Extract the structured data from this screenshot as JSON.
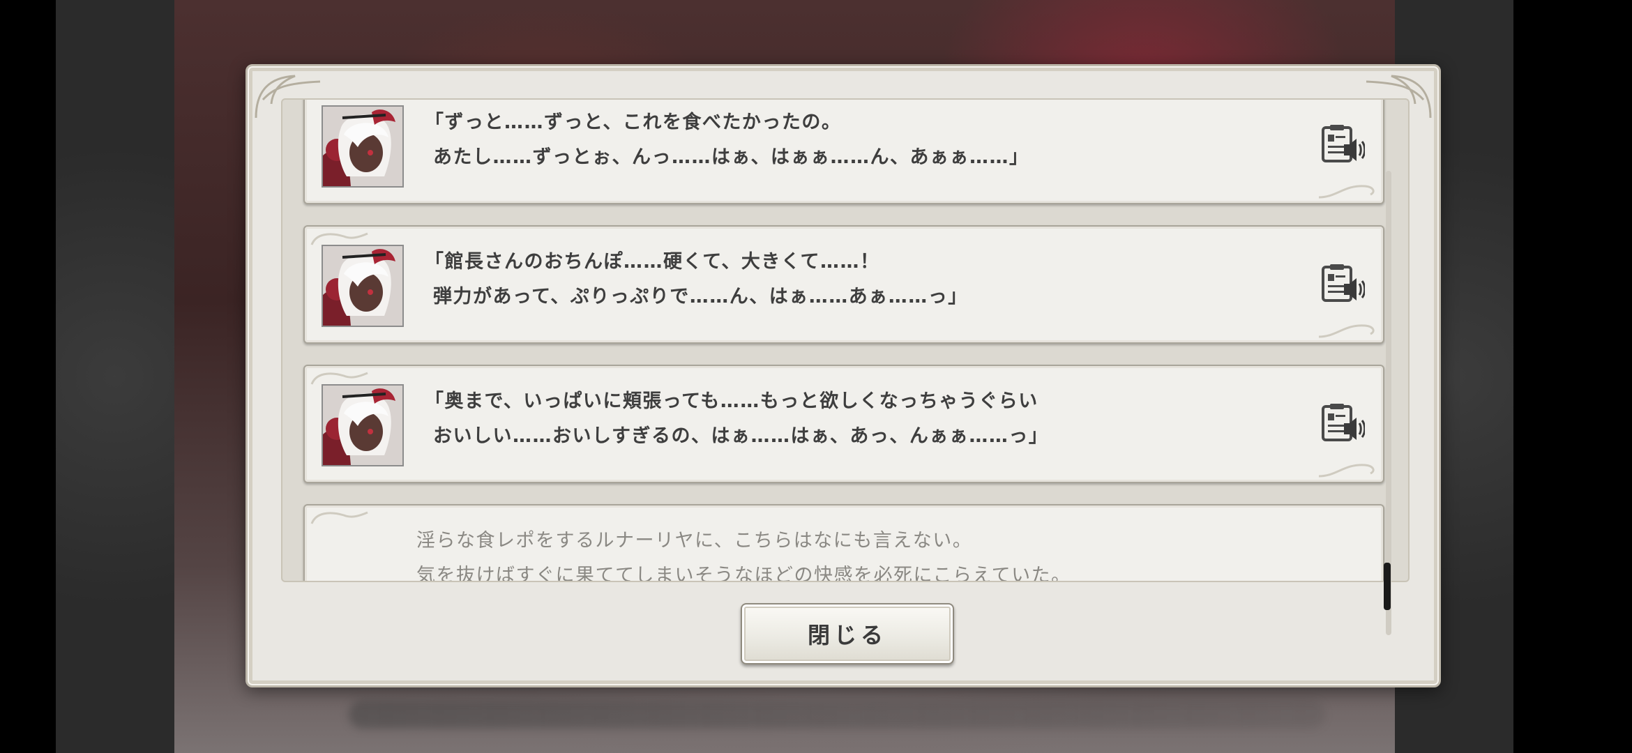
{
  "dialog": {
    "close_label": "閉じる"
  },
  "log": {
    "entries": [
      {
        "type": "character",
        "line1": "「ずっと……ずっと、これを食べたかったの。",
        "line2": "あたし……ずっとぉ、んっ……はぁ、はぁぁ……ん、あぁぁ……」",
        "icon": "voice-replay-icon"
      },
      {
        "type": "character",
        "line1": "「館長さんのおちんぽ……硬くて、大きくて……！",
        "line2": "弾力があって、ぷりっぷりで……ん、はぁ……あぁ……っ」",
        "icon": "voice-replay-icon"
      },
      {
        "type": "character",
        "line1": "「奥まで、いっぱいに頬張っても……もっと欲しくなっちゃうぐらい",
        "line2": "おいしい……おいしすぎるの、はぁ……はぁ、あっ、んぁぁ……っ」",
        "icon": "voice-replay-icon"
      },
      {
        "type": "narration",
        "line1": "淫らな食レポをするルナーリヤに、こちらはなにも言えない。",
        "line2": "気を抜けばすぐに果ててしまいそうなほどの快感を必死にこらえていた。"
      }
    ]
  },
  "colors": {
    "panel": "#e9e7e2",
    "entry_bg": "#f1f0ec",
    "text": "#3e3e3e",
    "narration_text": "#8a8883",
    "scroll_thumb": "#1a1a1a"
  }
}
